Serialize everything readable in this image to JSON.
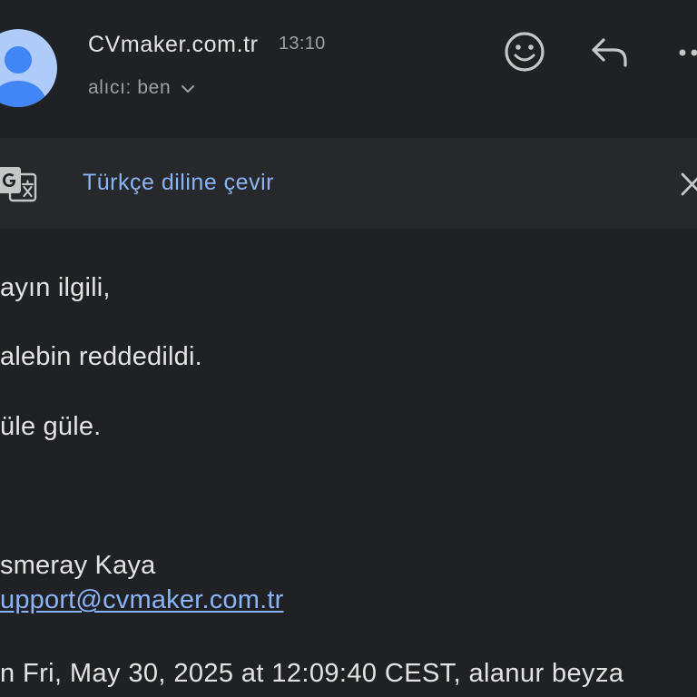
{
  "header": {
    "sender_name": "CVmaker.com.tr",
    "time": "13:10",
    "recipient_label": "alıcı: ben",
    "icons": {
      "avatar": "person-avatar-icon",
      "expand": "chevron-down-icon",
      "react": "add-emoji-icon",
      "reply": "reply-icon",
      "more": "more-options-icon"
    }
  },
  "translate_bar": {
    "label": "Türkçe diline çevir",
    "icon": "translate-icon",
    "close_icon": "close-icon"
  },
  "body": {
    "lines": [
      "ayın ilgili,",
      "alebin reddedildi.",
      "üle güle."
    ],
    "signature_name": "smeray Kaya",
    "signature_email": "upport@cvmaker.com.tr",
    "quote_header": "n Fri, May 30, 2025 at 12:09:40 CEST, alanur beyza"
  },
  "colors": {
    "background": "#202124",
    "banner": "#27282b",
    "text_primary": "#e3e3e3",
    "text_secondary": "#9aa0a6",
    "link": "#8ab4f8",
    "icon": "#c4c7c5",
    "avatar_bg": "#aecbfa",
    "avatar_fg": "#4285f4"
  }
}
